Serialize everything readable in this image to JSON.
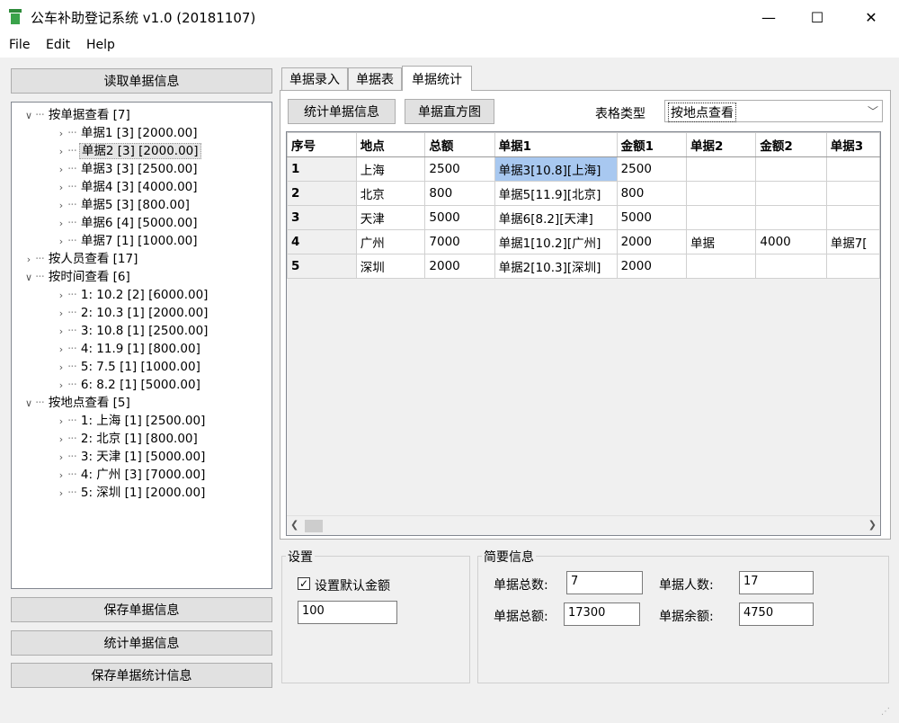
{
  "window": {
    "title": "公车补助登记系统 v1.0 (20181107)",
    "minimize_glyph": "—",
    "maximize_glyph": "☐",
    "close_glyph": "✕"
  },
  "menu": {
    "items": [
      "File",
      "Edit",
      "Help"
    ]
  },
  "left": {
    "read_button": "读取单据信息",
    "save_button": "保存单据信息",
    "stats_button": "统计单据信息",
    "save_stats_button": "保存单据统计信息"
  },
  "tree": [
    {
      "label": "按单据查看 [7]",
      "level": 0,
      "arrow": "expanded"
    },
    {
      "label": "单据1 [3] [2000.00]",
      "level": 1,
      "arrow": "collapsed"
    },
    {
      "label": "单据2 [3] [2000.00]",
      "level": 1,
      "arrow": "collapsed",
      "selected": true
    },
    {
      "label": "单据3 [3] [2500.00]",
      "level": 1,
      "arrow": "collapsed"
    },
    {
      "label": "单据4 [3] [4000.00]",
      "level": 1,
      "arrow": "collapsed"
    },
    {
      "label": "单据5 [3] [800.00]",
      "level": 1,
      "arrow": "collapsed"
    },
    {
      "label": "单据6 [4] [5000.00]",
      "level": 1,
      "arrow": "collapsed"
    },
    {
      "label": "单据7 [1] [1000.00]",
      "level": 1,
      "arrow": "collapsed"
    },
    {
      "label": "按人员查看 [17]",
      "level": 0,
      "arrow": "collapsed"
    },
    {
      "label": "按时间查看 [6]",
      "level": 0,
      "arrow": "expanded"
    },
    {
      "label": "1: 10.2 [2] [6000.00]",
      "level": 1,
      "arrow": "collapsed"
    },
    {
      "label": "2: 10.3 [1] [2000.00]",
      "level": 1,
      "arrow": "collapsed"
    },
    {
      "label": "3: 10.8 [1] [2500.00]",
      "level": 1,
      "arrow": "collapsed"
    },
    {
      "label": "4: 11.9 [1] [800.00]",
      "level": 1,
      "arrow": "collapsed"
    },
    {
      "label": "5: 7.5 [1] [1000.00]",
      "level": 1,
      "arrow": "collapsed"
    },
    {
      "label": "6: 8.2 [1] [5000.00]",
      "level": 1,
      "arrow": "collapsed"
    },
    {
      "label": "按地点查看 [5]",
      "level": 0,
      "arrow": "expanded"
    },
    {
      "label": "1: 上海 [1] [2500.00]",
      "level": 1,
      "arrow": "collapsed"
    },
    {
      "label": "2: 北京 [1] [800.00]",
      "level": 1,
      "arrow": "collapsed"
    },
    {
      "label": "3: 天津 [1] [5000.00]",
      "level": 1,
      "arrow": "collapsed"
    },
    {
      "label": "4: 广州 [3] [7000.00]",
      "level": 1,
      "arrow": "collapsed"
    },
    {
      "label": "5: 深圳 [1] [2000.00]",
      "level": 1,
      "arrow": "collapsed"
    }
  ],
  "tabs": [
    {
      "label": "单据录入",
      "active": false
    },
    {
      "label": "单据表",
      "active": false
    },
    {
      "label": "单据统计",
      "active": true
    }
  ],
  "stats_tab": {
    "stats_button": "统计单据信息",
    "histogram_button": "单据直方图",
    "table_type_label": "表格类型",
    "table_type_value": "按地点查看"
  },
  "grid": {
    "columns": [
      "序号",
      "地点",
      "总额",
      "单据1",
      "金额1",
      "单据2",
      "金额2",
      "单据3"
    ],
    "rows": [
      [
        "1",
        "上海",
        "2500",
        "单据3[10.8][上海]",
        "2500",
        "",
        "",
        ""
      ],
      [
        "2",
        "北京",
        "800",
        "单据5[11.9][北京]",
        "800",
        "",
        "",
        ""
      ],
      [
        "3",
        "天津",
        "5000",
        "单据6[8.2][天津]",
        "5000",
        "",
        "",
        ""
      ],
      [
        "4",
        "广州",
        "7000",
        "单据1[10.2][广州]",
        "2000",
        "单据",
        "4000",
        "单据7["
      ],
      [
        "5",
        "深圳",
        "2000",
        "单据2[10.3][深圳]",
        "2000",
        "",
        "",
        ""
      ]
    ]
  },
  "settings": {
    "group_title": "设置",
    "default_amount_label": "设置默认金额",
    "default_amount_checked": true,
    "default_amount_value": "100"
  },
  "summary": {
    "group_title": "简要信息",
    "total_count_label": "单据总数:",
    "total_count_value": "7",
    "people_count_label": "单据人数:",
    "people_count_value": "17",
    "total_amount_label": "单据总额:",
    "total_amount_value": "17300",
    "balance_label": "单据余额:",
    "balance_value": "4750"
  }
}
